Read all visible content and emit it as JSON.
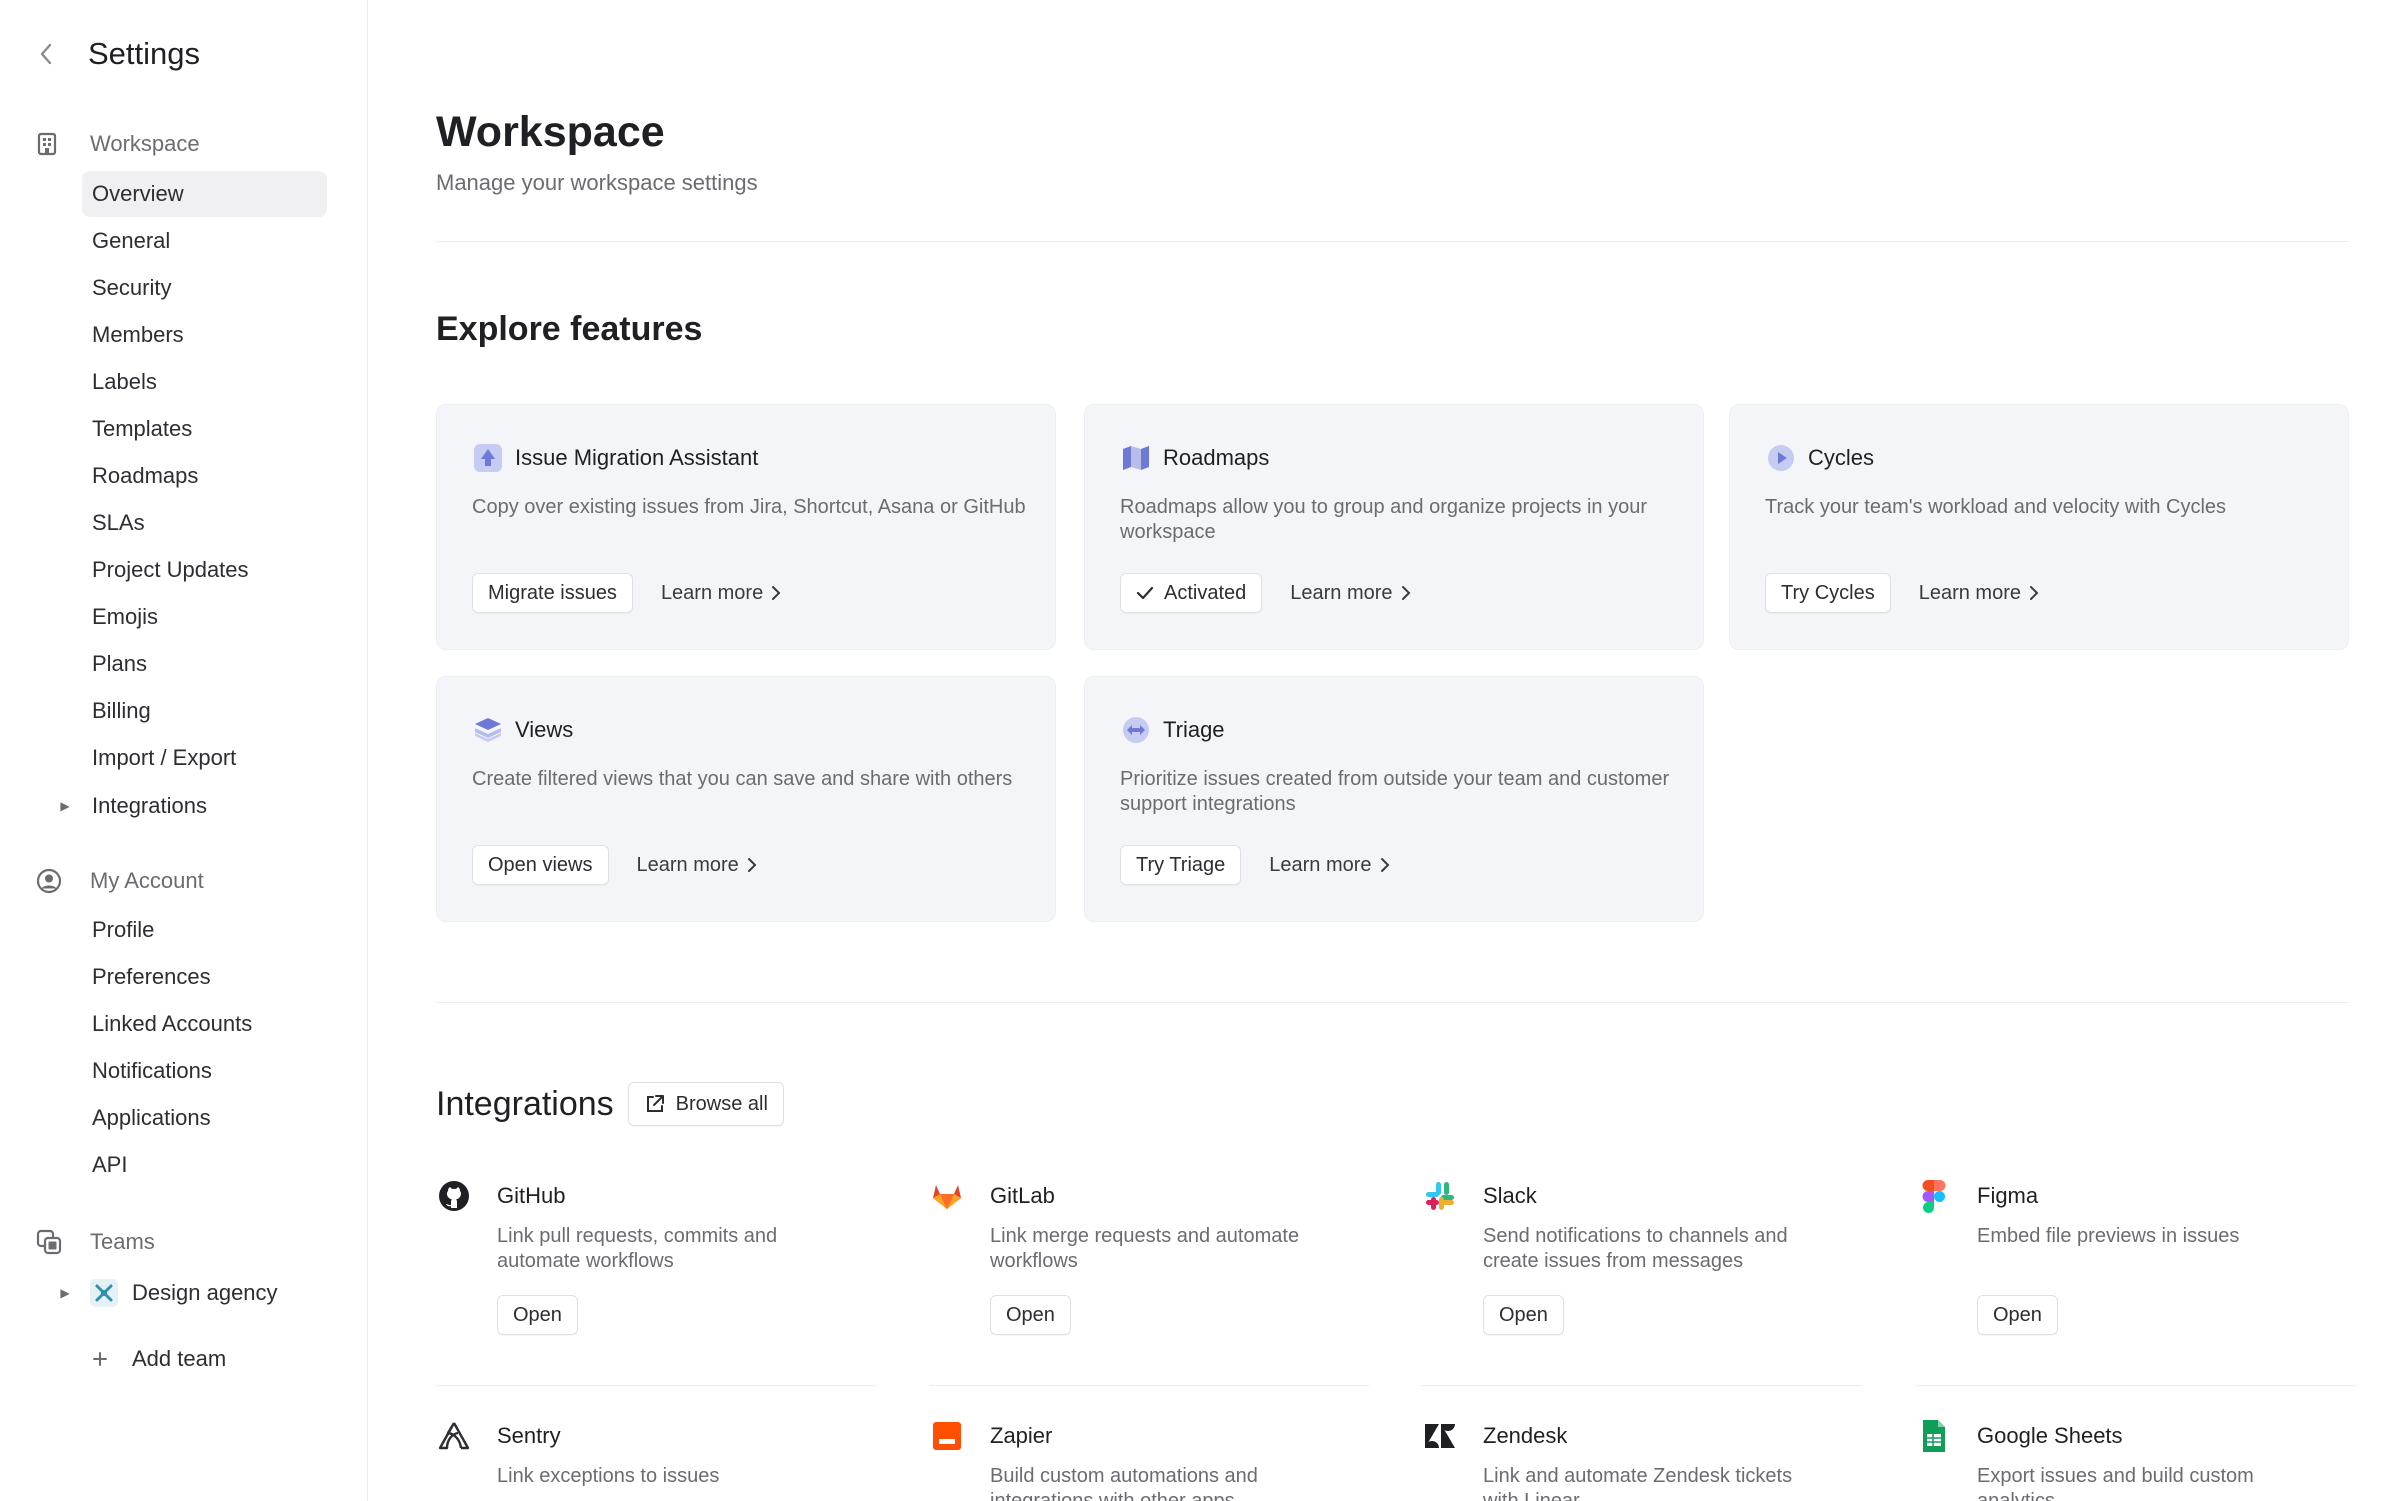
{
  "sidebar": {
    "title": "Settings",
    "workspace": {
      "label": "Workspace",
      "items": [
        "Overview",
        "General",
        "Security",
        "Members",
        "Labels",
        "Templates",
        "Roadmaps",
        "SLAs",
        "Project Updates",
        "Emojis",
        "Plans",
        "Billing",
        "Import / Export",
        "Integrations"
      ]
    },
    "account": {
      "label": "My Account",
      "items": [
        "Profile",
        "Preferences",
        "Linked Accounts",
        "Notifications",
        "Applications",
        "API"
      ]
    },
    "teams": {
      "label": "Teams",
      "team_name": "Design agency",
      "add_team": "Add team"
    }
  },
  "main": {
    "title": "Workspace",
    "subtitle": "Manage your workspace settings",
    "features_heading": "Explore features",
    "learn_more": "Learn more",
    "features": [
      {
        "title": "Issue Migration Assistant",
        "desc": "Copy over existing issues from Jira, Shortcut, Asana or GitHub",
        "action": "Migrate issues"
      },
      {
        "title": "Roadmaps",
        "desc": "Roadmaps allow you to group and organize projects in your workspace",
        "action": "Activated"
      },
      {
        "title": "Cycles",
        "desc": "Track your team's workload and velocity with Cycles",
        "action": "Try Cycles"
      },
      {
        "title": "Views",
        "desc": "Create filtered views that you can save and share with others",
        "action": "Open views"
      },
      {
        "title": "Triage",
        "desc": "Prioritize issues created from outside your team and customer support integrations",
        "action": "Try Triage"
      }
    ],
    "integrations_heading": "Integrations",
    "browse_all": "Browse all",
    "open_label": "Open",
    "integrations": [
      {
        "name": "GitHub",
        "desc": "Link pull requests, commits and automate workflows",
        "icon": "github-icon"
      },
      {
        "name": "GitLab",
        "desc": "Link merge requests and automate workflows",
        "icon": "gitlab-icon"
      },
      {
        "name": "Slack",
        "desc": "Send notifications to channels and create issues from messages",
        "icon": "slack-icon"
      },
      {
        "name": "Figma",
        "desc": "Embed file previews in issues",
        "icon": "figma-icon"
      },
      {
        "name": "Sentry",
        "desc": "Link exceptions to issues",
        "icon": "sentry-icon"
      },
      {
        "name": "Zapier",
        "desc": "Build custom automations and integrations with other apps",
        "icon": "zapier-icon"
      },
      {
        "name": "Zendesk",
        "desc": "Link and automate Zendesk tickets with Linear",
        "icon": "zendesk-icon"
      },
      {
        "name": "Google Sheets",
        "desc": "Export issues and build custom analytics",
        "icon": "google-sheets-icon"
      }
    ]
  },
  "colors": {
    "accent": "#6e79d6",
    "card_bg": "#f4f5f8",
    "active_item_bg": "#f0f0f3",
    "muted_text": "#6b6c72"
  }
}
